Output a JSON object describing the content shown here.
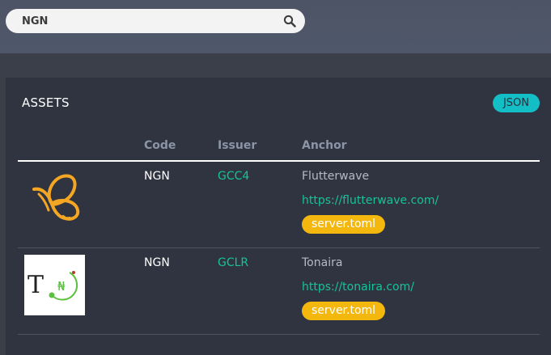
{
  "search": {
    "value": "NGN",
    "icon": "search-icon"
  },
  "assets": {
    "title": "ASSETS",
    "json_label": "JSON",
    "headers": {
      "logo": "",
      "code": "Code",
      "issuer": "Issuer",
      "anchor": "Anchor"
    },
    "rows": [
      {
        "logo": "flutterwave-logo",
        "code": "NGN",
        "issuer": "GCC4",
        "anchor_name": "Flutterwave",
        "anchor_url": "https://flutterwave.com/",
        "toml_label": "server.toml"
      },
      {
        "logo": "tonaira-logo",
        "code": "NGN",
        "issuer": "GCLR",
        "anchor_name": "Tonaira",
        "anchor_url": "https://tonaira.com/",
        "toml_label": "server.toml"
      }
    ]
  },
  "colors": {
    "accent_teal": "#13bec6",
    "link_green": "#15c39a",
    "toml_yellow": "#f3b70d",
    "flutterwave_gold": "#f5a623",
    "tonaira_green": "#5cc040"
  }
}
